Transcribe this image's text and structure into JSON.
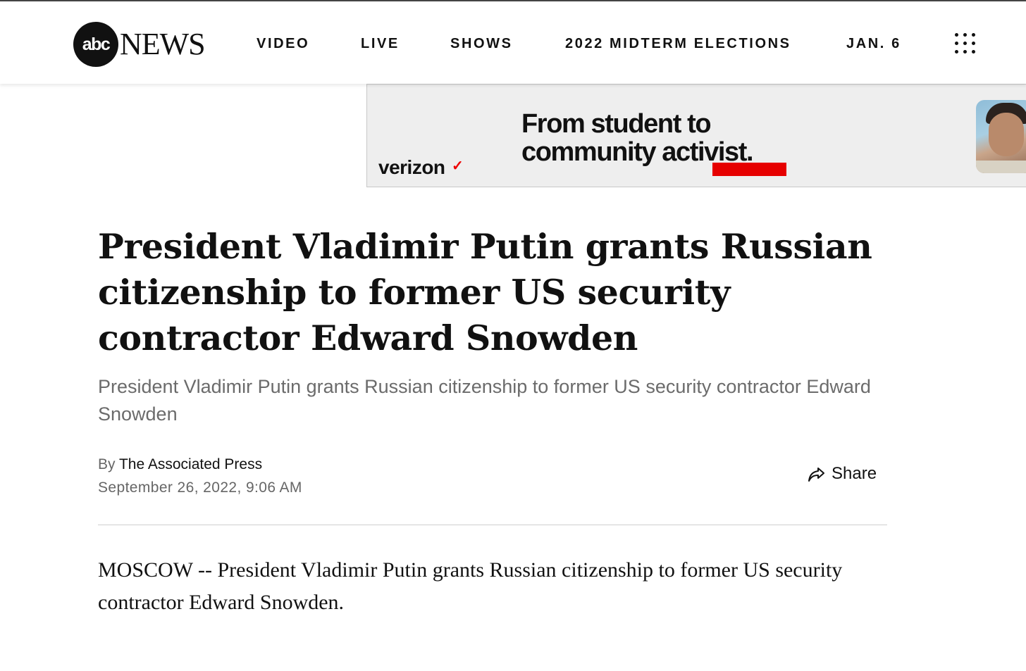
{
  "header": {
    "logo": {
      "circle_text": "abc",
      "word_text": "NEWS"
    },
    "nav": [
      {
        "label": "VIDEO"
      },
      {
        "label": "LIVE"
      },
      {
        "label": "SHOWS"
      },
      {
        "label": "2022 MIDTERM ELECTIONS"
      },
      {
        "label": "JAN. 6"
      }
    ],
    "menu_icon": "grid-dots-icon"
  },
  "ad": {
    "brand": "verizon",
    "brand_mark": "✓",
    "headline": "From student to community activist.",
    "accent_color": "#e60000"
  },
  "article": {
    "headline": "President Vladimir Putin grants Russian citizenship to former US security contractor Edward Snowden",
    "subhead": "President Vladimir Putin grants Russian citizenship to former US security contractor Edward Snowden",
    "byline_prefix": "By",
    "author": "The Associated Press",
    "date": "September 26, 2022, 9:06 AM",
    "share_label": "Share",
    "share_icon": "share-arrow-icon",
    "body": "MOSCOW -- President Vladimir Putin grants Russian citizenship to former US security contractor Edward Snowden."
  }
}
